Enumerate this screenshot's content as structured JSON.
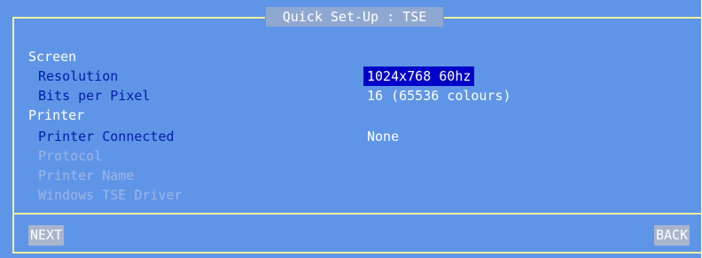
{
  "dialog": {
    "title": "Quick Set-Up : TSE"
  },
  "screen_section": {
    "heading": "Screen",
    "resolution_label": "Resolution",
    "resolution_value": "1024x768 60hz",
    "bpp_label": "Bits per Pixel",
    "bpp_value": "16 (65536 colours)"
  },
  "printer_section": {
    "heading": "Printer",
    "connected_label": "Printer Connected",
    "connected_value": "None",
    "protocol_label": "Protocol",
    "name_label": "Printer Name",
    "driver_label": "Windows TSE Driver"
  },
  "footer": {
    "next_label": "NEXT",
    "back_label": "BACK"
  },
  "colors": {
    "background": "#5f95e7",
    "frame": "#f2f09a",
    "label": "#001ea8",
    "disabled_label": "#9db5e6",
    "selection": "#0000c9",
    "key_bg": "#a9b5cb"
  }
}
